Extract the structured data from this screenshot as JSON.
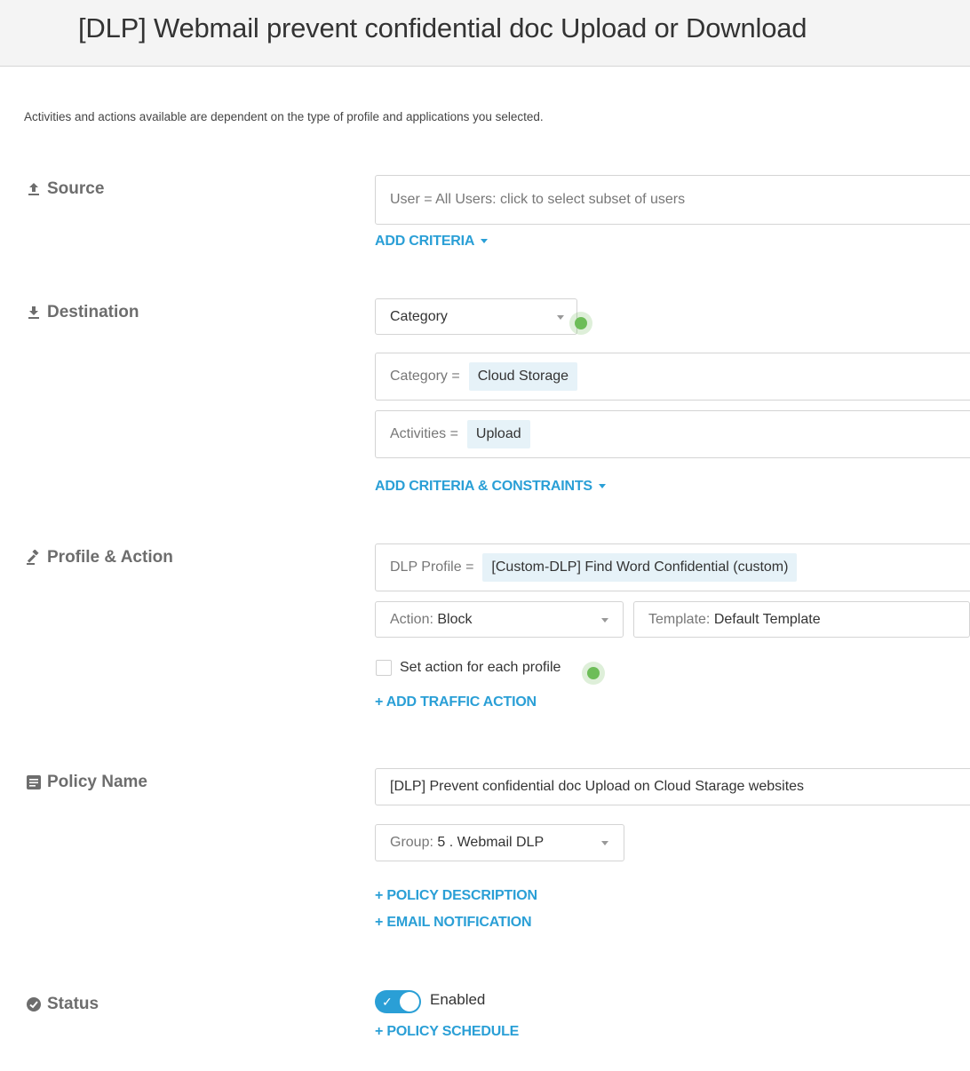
{
  "header": {
    "title": "[DLP] Webmail prevent confidential doc Upload or Download"
  },
  "note": "Activities and actions available are dependent on the type of profile and applications you selected.",
  "source": {
    "label": "Source",
    "user_field": "User = All Users: click to select subset of users",
    "add_criteria": "ADD CRITERIA"
  },
  "destination": {
    "label": "Destination",
    "type_select": "Category",
    "category": {
      "key": "Category =",
      "value": "Cloud Storage"
    },
    "activities": {
      "key": "Activities =",
      "value": "Upload"
    },
    "add_criteria": "ADD CRITERIA & CONSTRAINTS"
  },
  "profile_action": {
    "label": "Profile & Action",
    "dlp_profile": {
      "key": "DLP Profile =",
      "value": "[Custom-DLP] Find Word Confidential (custom)"
    },
    "action": {
      "key": "Action:",
      "value": "Block"
    },
    "template": {
      "key": "Template:",
      "value": "Default Template"
    },
    "set_action_checkbox": "Set action for each profile",
    "add_traffic_action": "+ ADD TRAFFIC ACTION"
  },
  "policy_name": {
    "label": "Policy Name",
    "value": "[DLP] Prevent confidential doc Upload on Cloud Starage websites",
    "group": {
      "key": "Group:",
      "value": "5 . Webmail DLP"
    },
    "policy_description": "+ POLICY DESCRIPTION",
    "email_notification": "+ EMAIL NOTIFICATION"
  },
  "status": {
    "label": "Status",
    "toggle_label": "Enabled",
    "toggle_on": true,
    "policy_schedule": "+ POLICY SCHEDULE"
  },
  "colors": {
    "accent": "#2a9fd6",
    "indicator": "#6dbd58",
    "chip": "#e6f2f8"
  },
  "icons": [
    "upload-icon",
    "download-icon",
    "gavel-icon",
    "document-icon",
    "check-circle-icon"
  ]
}
